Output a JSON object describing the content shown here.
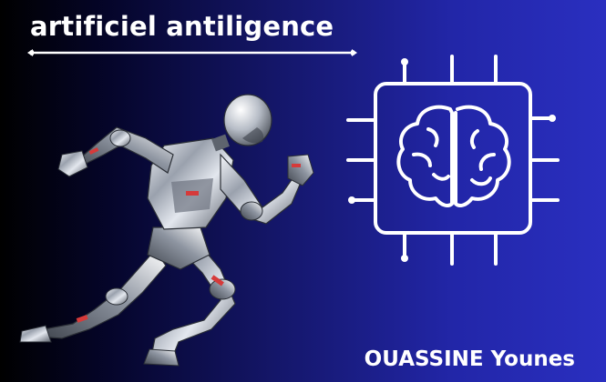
{
  "title": "artificiel antiligence",
  "author": "OUASSINE Younes",
  "colors": {
    "background_left": "#000000",
    "background_right": "#2a2fc0",
    "text": "#ffffff",
    "robot_metal": "#c9ced8",
    "robot_accent": "#d63a3a"
  },
  "icons": {
    "illustration": "running-robot-illustration",
    "chip": "ai-brain-chip-icon",
    "underline": "double-ended-line-decoration"
  }
}
